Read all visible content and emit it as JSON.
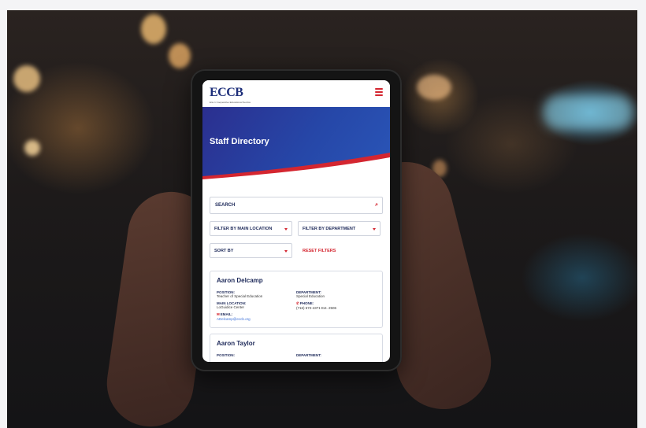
{
  "header": {
    "logo_text": "ECCB",
    "logo_subtitle": "Erie 1 Cooperative Educational Services"
  },
  "hero": {
    "title": "Staff Directory"
  },
  "filters": {
    "search_label": "SEARCH",
    "location_label": "FILTER BY MAIN LOCATION",
    "department_label": "FILTER BY DEPARTMENT",
    "sort_label": "SORT BY",
    "reset_label": "RESET FILTERS"
  },
  "staff": [
    {
      "name": "Aaron Delcamp",
      "position_label": "POSITION:",
      "position": "Teacher of Special Education",
      "department_label": "DEPARTMENT:",
      "department": "Special Education",
      "location_label": "MAIN LOCATION:",
      "location": "LoGuidice Center",
      "phone_label": "PHONE:",
      "phone": "(716) 672-4371 Ext. 2506",
      "email_label": "EMAIL:",
      "email": "ADelcamp@eccb.org"
    },
    {
      "name": "Aaron Taylor",
      "position_label": "POSITION:",
      "department_label": "DEPARTMENT:"
    }
  ],
  "colors": {
    "brand_blue": "#1e2f7a",
    "accent_red": "#d42630",
    "hero_blue": "#2647a8"
  }
}
